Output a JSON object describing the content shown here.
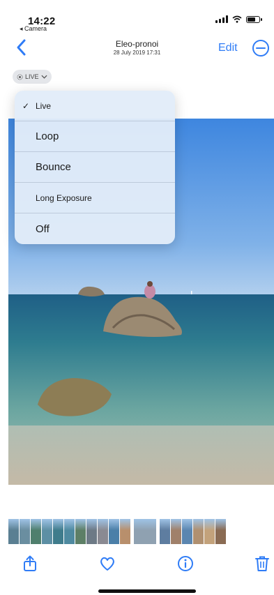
{
  "status": {
    "time": "14:22",
    "back_app": "◂ Camera"
  },
  "nav": {
    "title": "Eleo-pronoi",
    "subtitle": "28 July 2019 17:31",
    "edit_label": "Edit"
  },
  "live_pill": {
    "label": "LIVE"
  },
  "menu": {
    "items": [
      {
        "label": "Live",
        "checked": true
      },
      {
        "label": "Loop",
        "checked": false
      },
      {
        "label": "Bounce",
        "checked": false
      },
      {
        "label": "Long Exposure",
        "checked": false
      },
      {
        "label": "Off",
        "checked": false
      }
    ]
  },
  "filmstrip": {
    "thumbs": [
      "#5a7f92",
      "#6a8ea0",
      "#4f7f6d",
      "#5d8fa4",
      "#3f7c8c",
      "#4f8aa0",
      "#5d7f66",
      "#6d7a86",
      "#8a8a92",
      "#4b7fa8",
      "#b88f6c",
      "#8fa1b1",
      "#5e7da0",
      "#a0806a",
      "#5b86b0",
      "#b09070",
      "#c3a27b",
      "#8a6b53"
    ],
    "selected_index": 11
  },
  "colors": {
    "accent": "#2f7cf6",
    "menu_bg": "#e2ecf9",
    "sky_top": "#4a8fe0",
    "sea": "#2f7c8e"
  },
  "icons": {
    "back": "chevron-left-icon",
    "more": "ellipsis-circle-icon",
    "share": "share-icon",
    "favorite": "heart-icon",
    "info": "info-icon",
    "delete": "trash-icon"
  }
}
